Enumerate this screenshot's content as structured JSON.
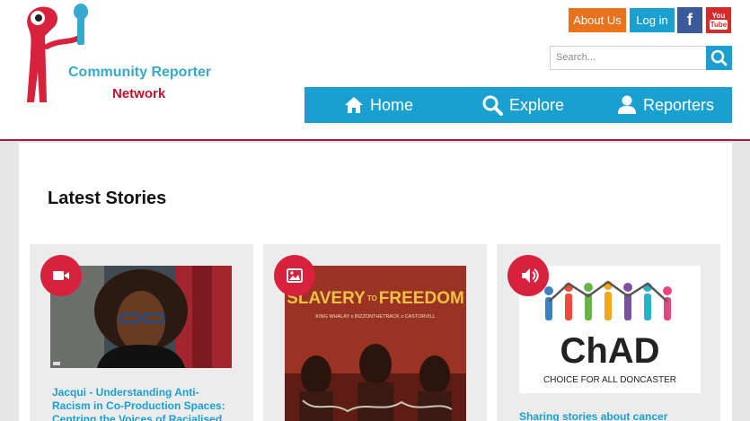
{
  "logo": {
    "line1": "Community Reporter",
    "line2": "Network",
    "icon": "community-reporter-mascot-icon"
  },
  "header": {
    "about_label": "About Us",
    "login_label": "Log in",
    "facebook_glyph": "f",
    "youtube_line1": "You",
    "youtube_line2": "Tube"
  },
  "search": {
    "placeholder": "Search..."
  },
  "nav": {
    "items": [
      {
        "label": "Home",
        "icon": "home-icon"
      },
      {
        "label": "Explore",
        "icon": "search-icon"
      },
      {
        "label": "Reporters",
        "icon": "user-icon"
      }
    ]
  },
  "main": {
    "section_title": "Latest Stories",
    "cards": [
      {
        "type_icon": "video-camera-icon",
        "title": "Jacqui - Understanding Anti-Racism in Co-Production Spaces: Centring the Voices of Racialised Individuals"
      },
      {
        "type_icon": "image-icon",
        "poster_title_left": "SLAVERY",
        "poster_title_mid": "TO",
        "poster_title_right": "FREEDOM",
        "poster_credits": "KING WHALAY x BIZZONTHETRACK x CASTORVILL",
        "title": ""
      },
      {
        "type_icon": "audio-icon",
        "chad_logo": "ChAD",
        "chad_tagline": "CHOICE FOR ALL DONCASTER",
        "title": "Sharing stories about cancer"
      }
    ]
  },
  "colors": {
    "brand_blue": "#1a9fd1",
    "brand_red": "#d8223d",
    "about_orange": "#e8731c",
    "facebook_blue": "#3b5a9a",
    "youtube_red": "#d42b2b"
  }
}
